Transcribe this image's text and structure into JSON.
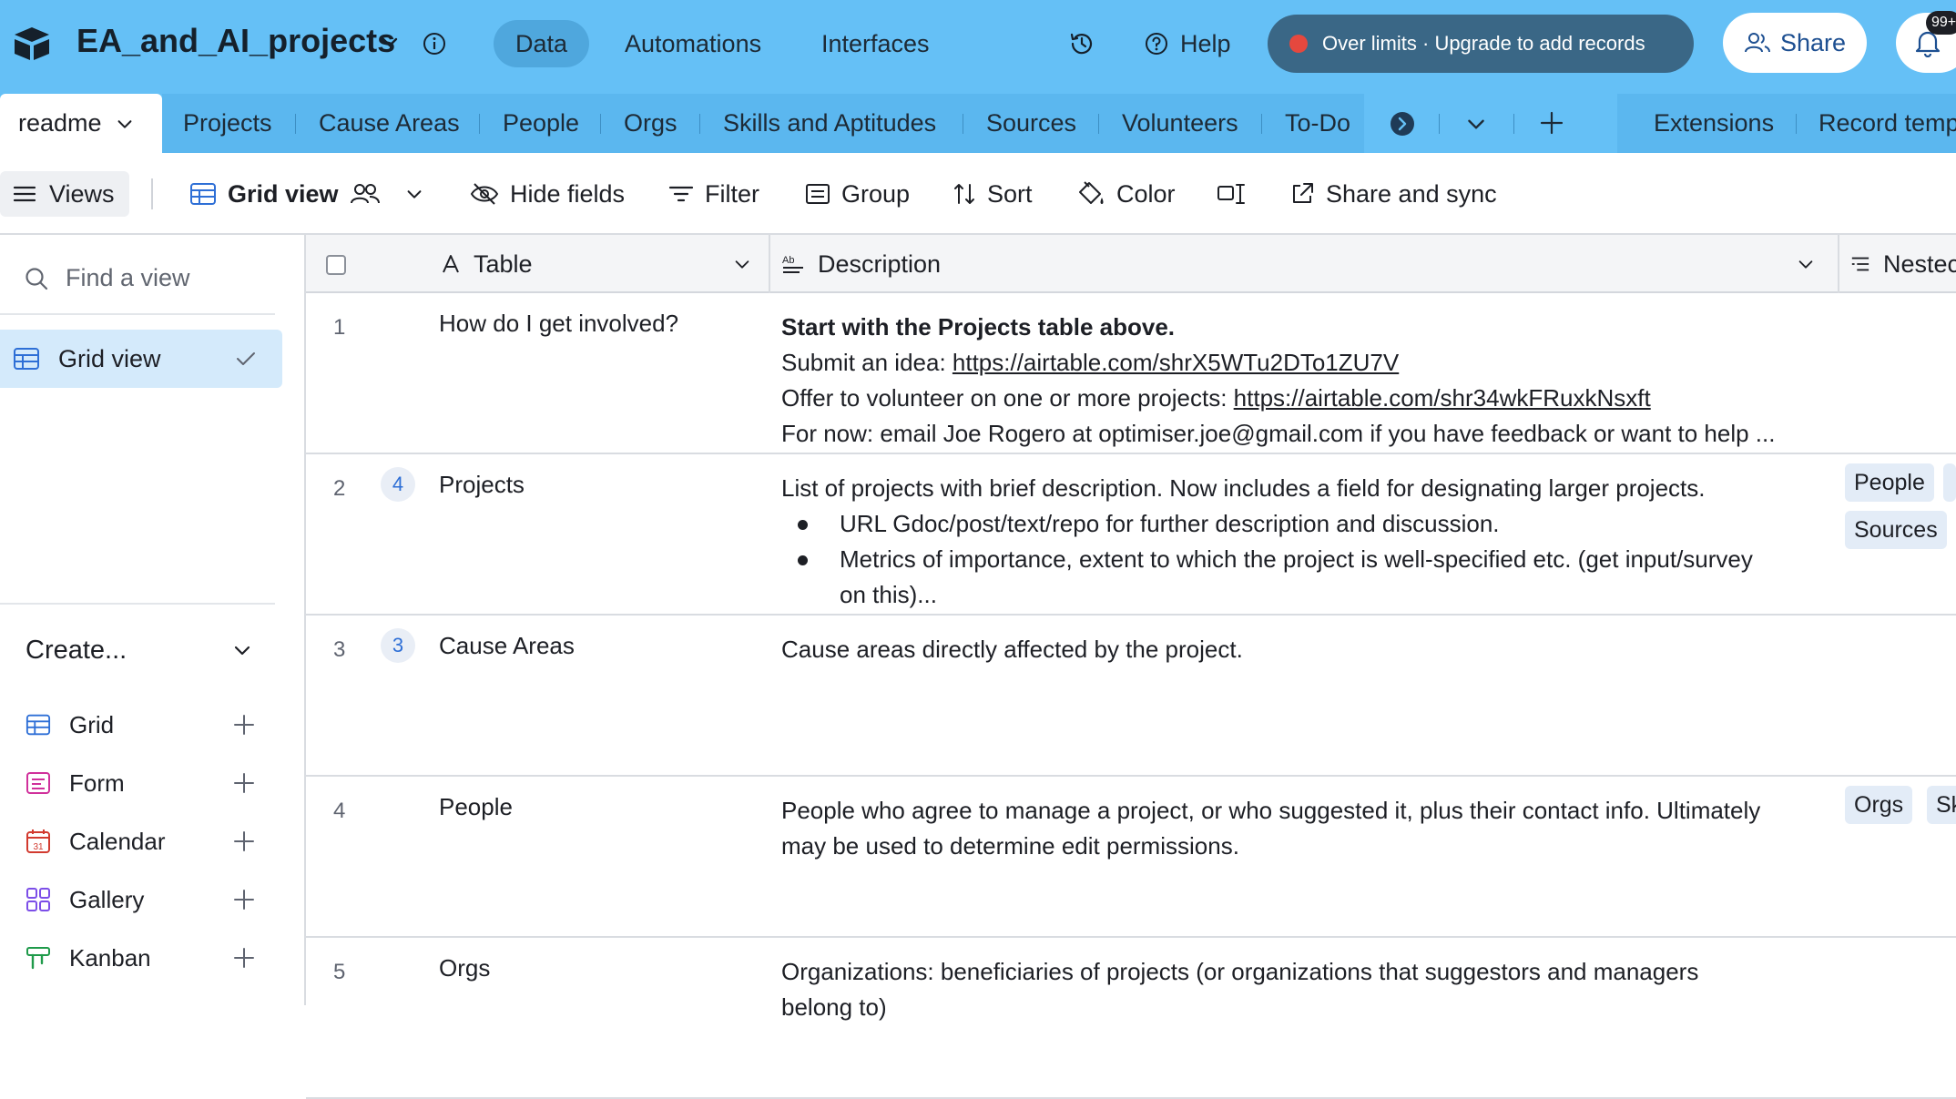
{
  "app": {
    "title": "EA_and_AI_projects",
    "nav": [
      "Data",
      "Automations",
      "Interfaces"
    ],
    "help_label": "Help",
    "over_limits": "Over limits · Upgrade to add records",
    "share_label": "Share",
    "notification_badge": "99+"
  },
  "tabs": {
    "active": "readme",
    "items": [
      "Projects",
      "Cause Areas",
      "People",
      "Orgs",
      "Skills and Aptitudes",
      "Sources",
      "Volunteers",
      "To-Do"
    ],
    "extensions": "Extensions",
    "record_templates": "Record temp"
  },
  "viewbar": {
    "views_label": "Views",
    "view_name": "Grid view",
    "hide_fields": "Hide fields",
    "filter": "Filter",
    "group": "Group",
    "sort": "Sort",
    "color": "Color",
    "share_sync": "Share and sync"
  },
  "sidebar": {
    "find_placeholder": "Find a view",
    "current_view": "Grid view",
    "create_label": "Create...",
    "create_items": [
      "Grid",
      "Form",
      "Calendar",
      "Gallery",
      "Kanban"
    ]
  },
  "grid": {
    "columns": [
      "Table",
      "Description",
      "Nestec"
    ],
    "rows": [
      {
        "num": "1",
        "count": "",
        "name": "How do I get involved?",
        "desc_bold": "Start with the Projects table above.",
        "desc_line2_prefix": "Submit an idea: ",
        "desc_line2_link": "https://airtable.com/shrX5WTu2DTo1ZU7V",
        "desc_line3_prefix": "Offer to volunteer on one or more projects: ",
        "desc_line3_link": "https://airtable.com/shr34wkFRuxkNsxft",
        "desc_line4": "For now: email Joe Rogero at optimiser.joe@gmail.com if you have feedback or want to help ..."
      },
      {
        "num": "2",
        "count": "4",
        "name": "Projects",
        "desc": "List of projects with brief description. Now includes a field for designating larger projects.",
        "bullet1": "URL Gdoc/post/text/repo for further description and discussion.",
        "bullet2a": "Metrics of importance, extent to which the project is well-specified etc. (get input/survey",
        "bullet2b": "on this)...",
        "chips": [
          "People",
          "Sources"
        ]
      },
      {
        "num": "3",
        "count": "3",
        "name": "Cause Areas",
        "desc": "Cause areas directly affected by the project."
      },
      {
        "num": "4",
        "count": "",
        "name": "People",
        "desc_a": "People who agree to manage a project, or who suggested it, plus their contact info. Ultimately",
        "desc_b": "may be used to determine edit permissions.",
        "chips": [
          "Orgs",
          "Sk"
        ]
      },
      {
        "num": "5",
        "count": "",
        "name": "Orgs",
        "desc_a": "Organizations: beneficiaries of projects (or organizations that suggestors and managers",
        "desc_b": "belong to)"
      }
    ]
  },
  "colors": {
    "appbar": "#65c0f6",
    "accent_blue": "#2e6fd6",
    "limits_bg": "#3a6786",
    "limits_dot": "#e5483e",
    "selected_view_bg": "#d4eafb"
  }
}
